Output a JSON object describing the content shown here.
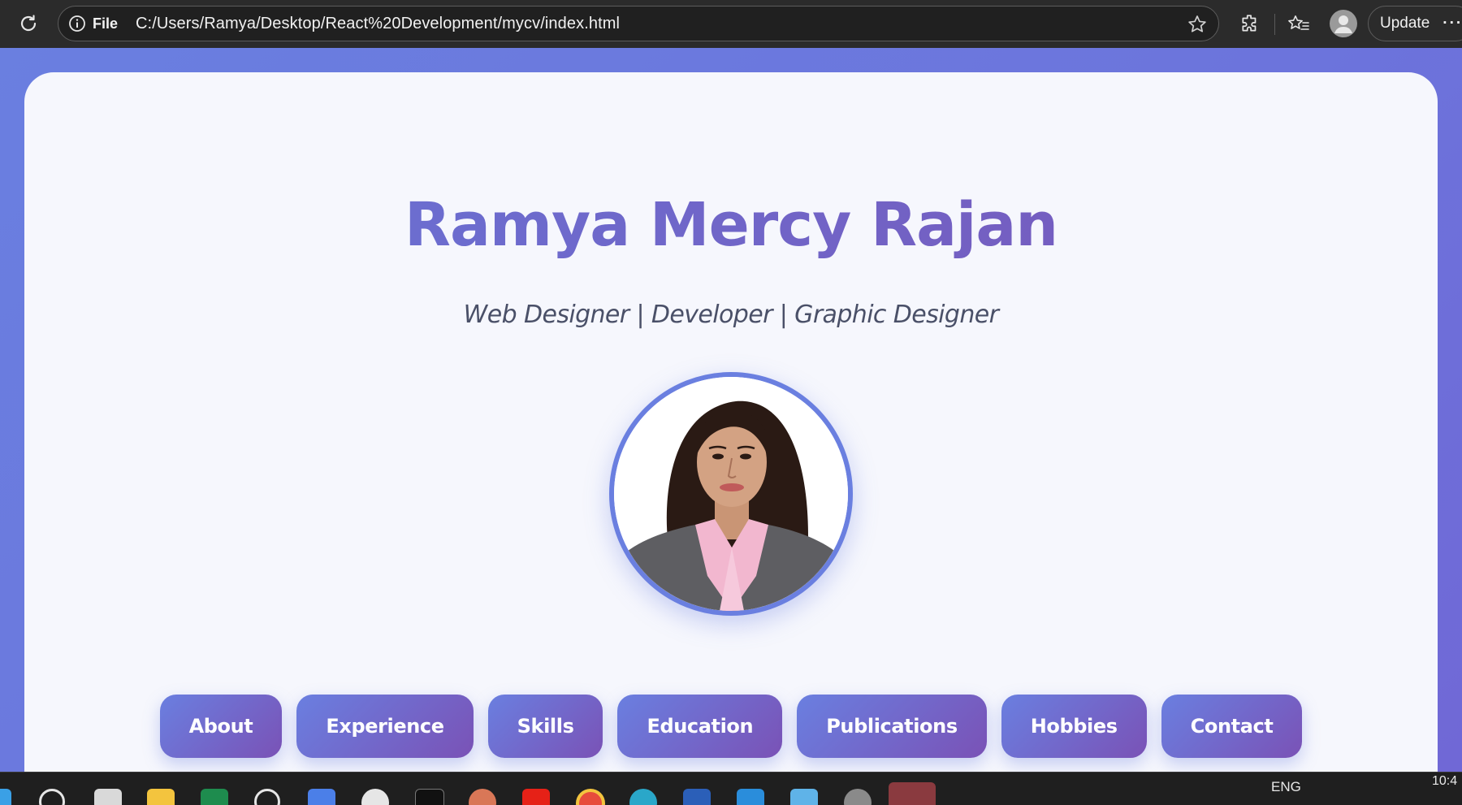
{
  "browser": {
    "address_label": "File",
    "url": "C:/Users/Ramya/Desktop/React%20Development/mycv/index.html",
    "update_label": "Update",
    "more_label": "···"
  },
  "profile": {
    "name": "Ramya Mercy Rajan",
    "tagline": "Web Designer | Developer | Graphic Designer",
    "accent_color": "#6a7fe0",
    "secondary_color": "#7a52b6"
  },
  "nav": {
    "items": [
      {
        "label": "About"
      },
      {
        "label": "Experience"
      },
      {
        "label": "Skills"
      },
      {
        "label": "Education"
      },
      {
        "label": "Publications"
      },
      {
        "label": "Hobbies"
      },
      {
        "label": "Contact"
      }
    ]
  },
  "taskbar": {
    "icons": [
      "start-icon",
      "search-icon",
      "task-view-icon",
      "file-explorer-icon",
      "excel-icon",
      "chatgpt-icon",
      "copilot-icon",
      "app-icon",
      "terminal-icon",
      "claude-icon",
      "youtube-icon",
      "chrome-icon",
      "edge-icon",
      "word-icon",
      "vscode-icon",
      "notepad-icon",
      "settings-icon",
      "app-active-icon"
    ],
    "language": "ENG",
    "time": "10:4"
  }
}
